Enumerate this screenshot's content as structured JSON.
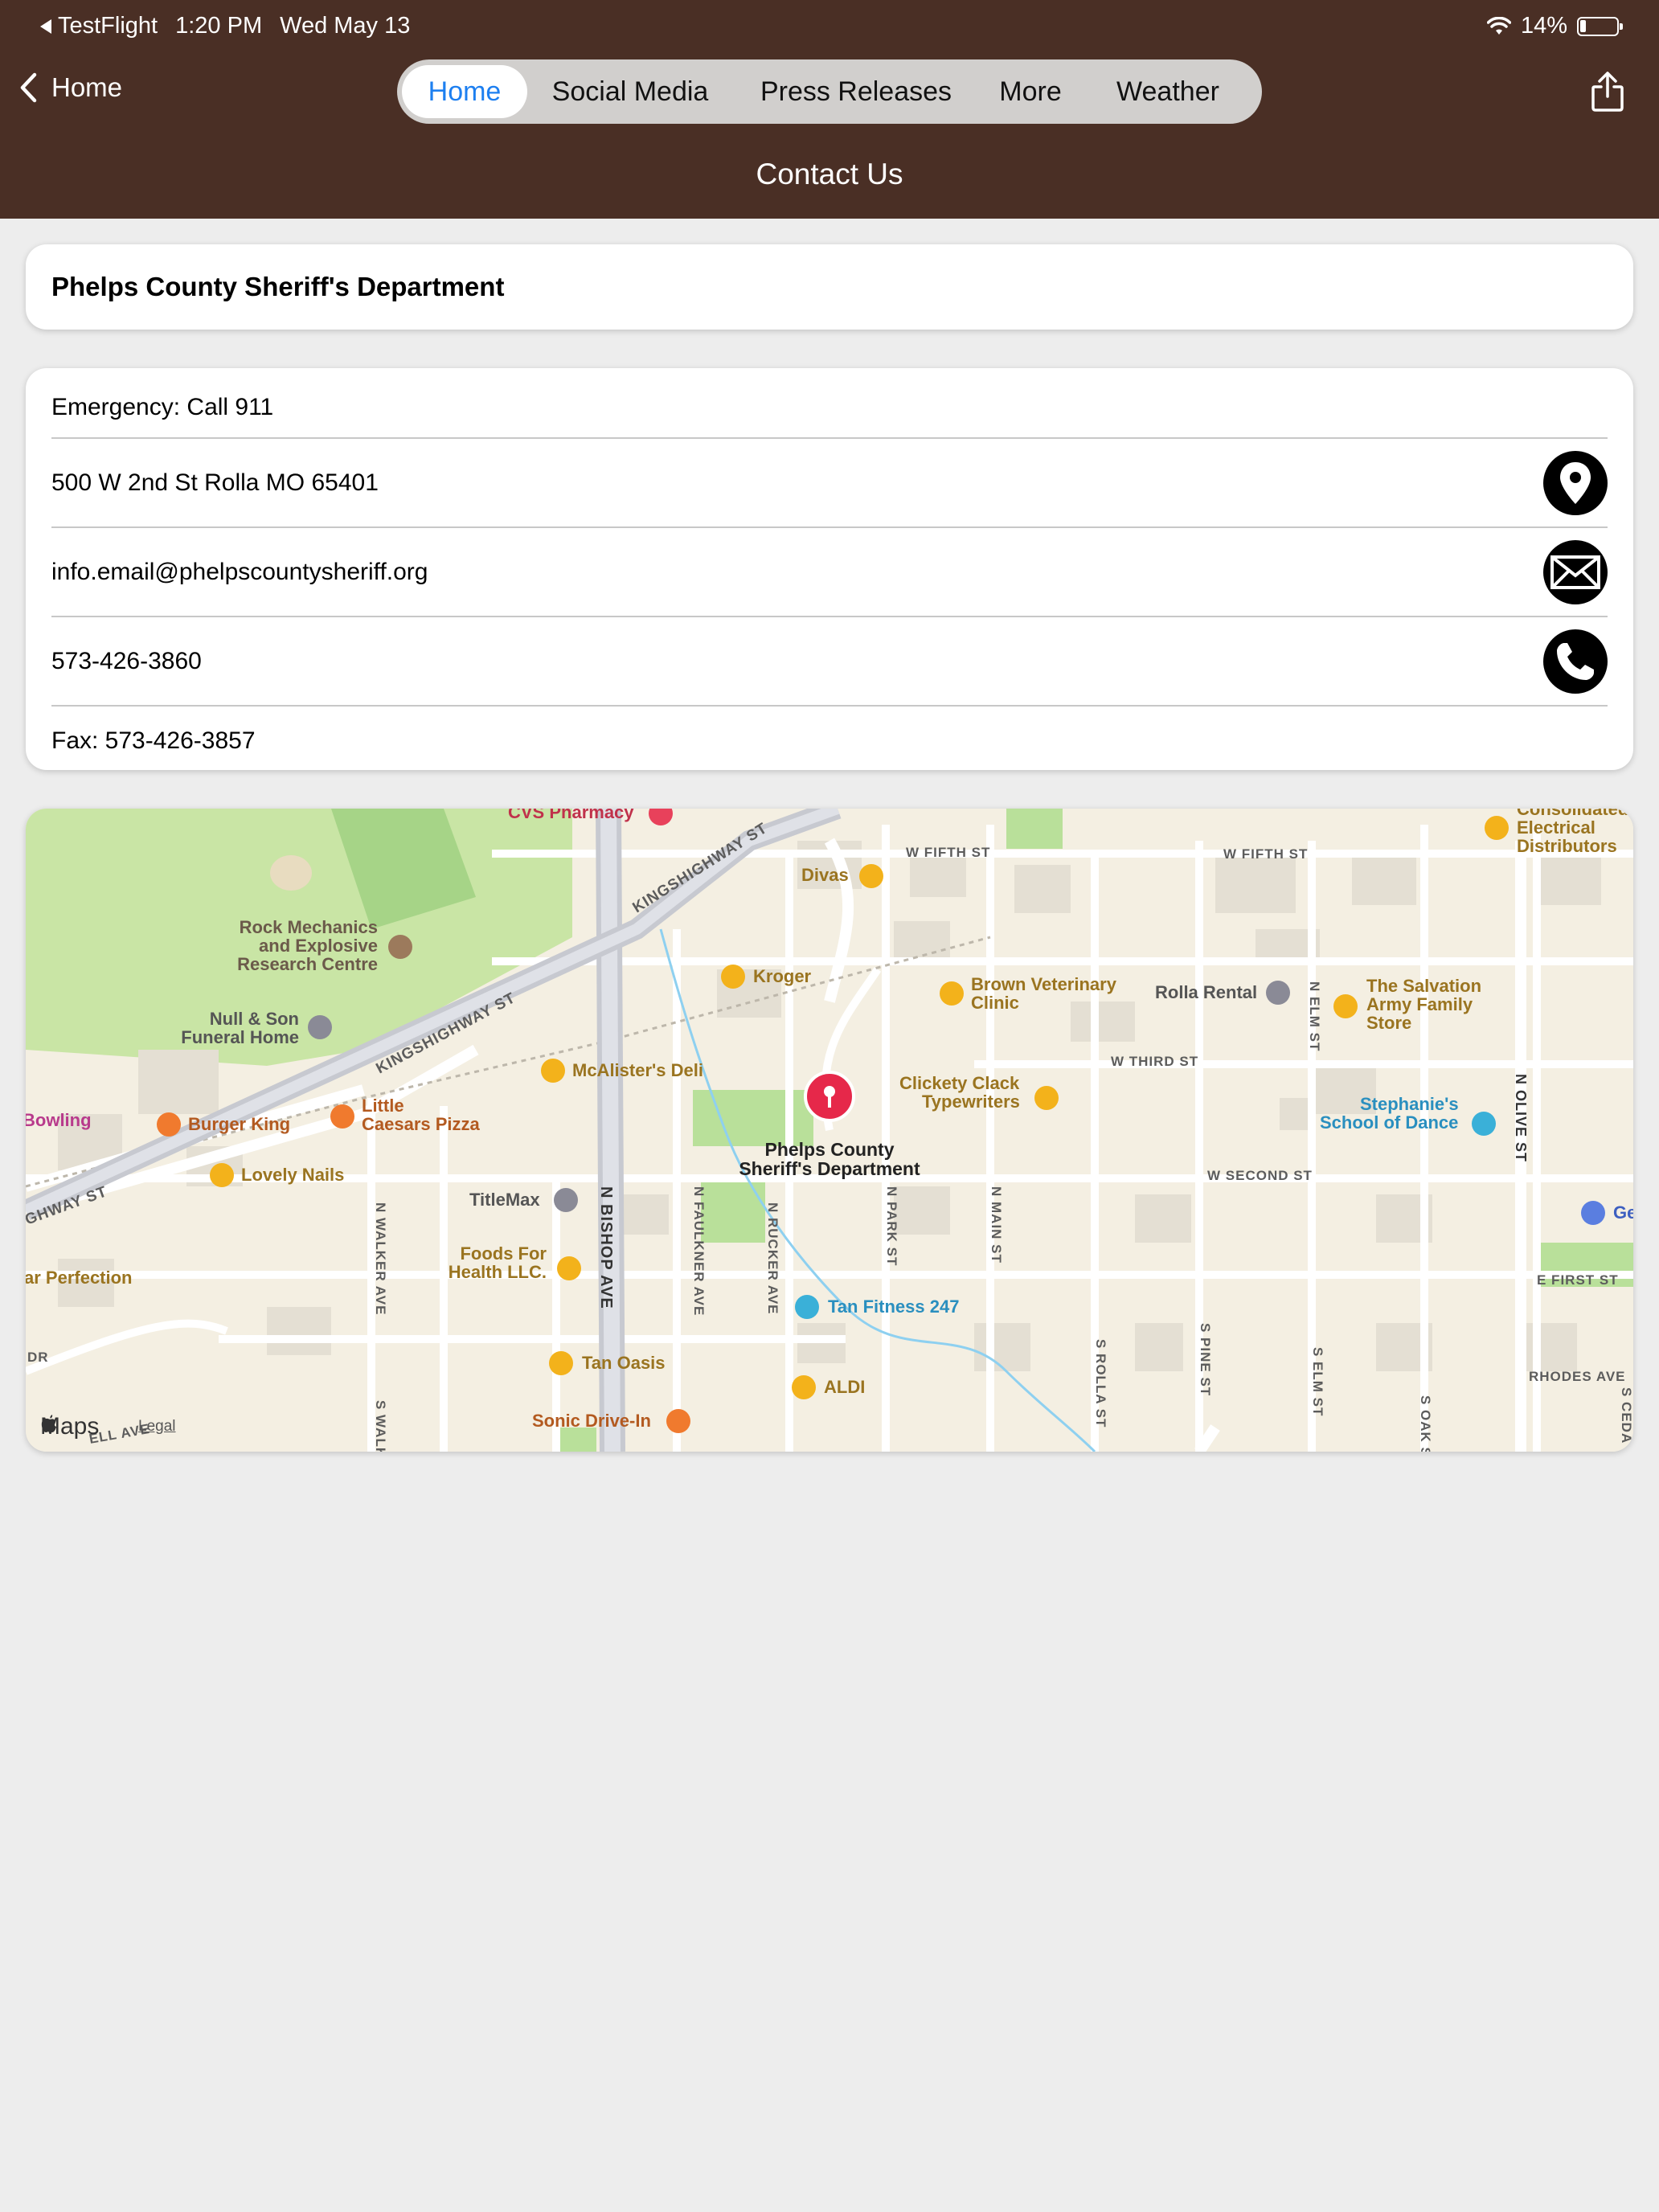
{
  "status_bar": {
    "app": "TestFlight",
    "time": "1:20 PM",
    "date": "Wed May 13",
    "battery": "14%"
  },
  "nav": {
    "back_label": "Home",
    "title": "Contact Us",
    "tabs": [
      {
        "label": "Home"
      },
      {
        "label": "Social Media"
      },
      {
        "label": "Press Releases"
      },
      {
        "label": "More"
      },
      {
        "label": "Weather"
      }
    ]
  },
  "org_name": "Phelps County Sheriff's Department",
  "contact": {
    "emergency": "Emergency: Call 911",
    "address": "500 W 2nd St Rolla MO 65401",
    "email": "info.email@phelpscountysheriff.org",
    "phone": "573-426-3860",
    "fax": "Fax: 573-426-3857"
  },
  "map": {
    "pin_label_1": "Phelps County",
    "pin_label_2": "Sheriff's Department",
    "attribution": "Maps",
    "legal": "Legal",
    "places": [
      {
        "label": "CVS Pharmacy"
      },
      {
        "label": "Divas"
      },
      {
        "label": "Kroger"
      },
      {
        "label": "Brown Veterinary"
      },
      {
        "label": "Clinic"
      },
      {
        "label": "Rolla Rental"
      },
      {
        "label": "The Salvation"
      },
      {
        "label": "Army Family"
      },
      {
        "label": "Store"
      },
      {
        "label": "Consolidated"
      },
      {
        "label": "Electrical"
      },
      {
        "label": "Distributors"
      },
      {
        "label": "Rock Mechanics"
      },
      {
        "label": "and Explosive"
      },
      {
        "label": "Research Centre"
      },
      {
        "label": "Null & Son"
      },
      {
        "label": "Funeral Home"
      },
      {
        "label": "McAlister's Deli"
      },
      {
        "label": "Clickety Clack"
      },
      {
        "label": "Typewriters"
      },
      {
        "label": "Stephanie's"
      },
      {
        "label": "School of Dance"
      },
      {
        "label": "Burger King"
      },
      {
        "label": "Little"
      },
      {
        "label": "Caesars Pizza"
      },
      {
        "label": "Bowling"
      },
      {
        "label": "Lovely Nails"
      },
      {
        "label": "TitleMax"
      },
      {
        "label": "Foods For"
      },
      {
        "label": "Health LLC."
      },
      {
        "label": "Tan Fitness 247"
      },
      {
        "label": "Tan Oasis"
      },
      {
        "label": "ALDI"
      },
      {
        "label": "Sonic Drive-In"
      },
      {
        "label": "ar Perfection"
      },
      {
        "label": "Ge"
      }
    ],
    "streets": [
      {
        "label": "W FIFTH ST"
      },
      {
        "label": "W FIFTH ST"
      },
      {
        "label": "KINGSHIGHWAY ST"
      },
      {
        "label": "KINGSHIGHWAY ST"
      },
      {
        "label": "IGHWAY ST"
      },
      {
        "label": "W THIRD ST"
      },
      {
        "label": "W SECOND ST"
      },
      {
        "label": "E FIRST ST"
      },
      {
        "label": "RHODES AVE"
      },
      {
        "label": "N BISHOP AVE"
      },
      {
        "label": "N WALKER AVE"
      },
      {
        "label": "N FAULKNER AVE"
      },
      {
        "label": "N RUCKER AVE"
      },
      {
        "label": "N PARK ST"
      },
      {
        "label": "N MAIN ST"
      },
      {
        "label": "N ELM ST"
      },
      {
        "label": "N OLIVE ST"
      },
      {
        "label": "S ROLLA ST"
      },
      {
        "label": "S PINE ST"
      },
      {
        "label": "S ELM ST"
      },
      {
        "label": "S OAK S"
      },
      {
        "label": "S CEDA"
      },
      {
        "label": "S WALK"
      },
      {
        "label": "DR"
      },
      {
        "label": "ELL AVE"
      }
    ]
  },
  "colors": {
    "header_bg": "#4a2f25",
    "accent": "#1d7ff0",
    "page_bg": "#ededed"
  },
  "icons": [
    "location-pin-icon",
    "envelope-icon",
    "phone-icon",
    "share-icon",
    "chevron-left-icon"
  ]
}
